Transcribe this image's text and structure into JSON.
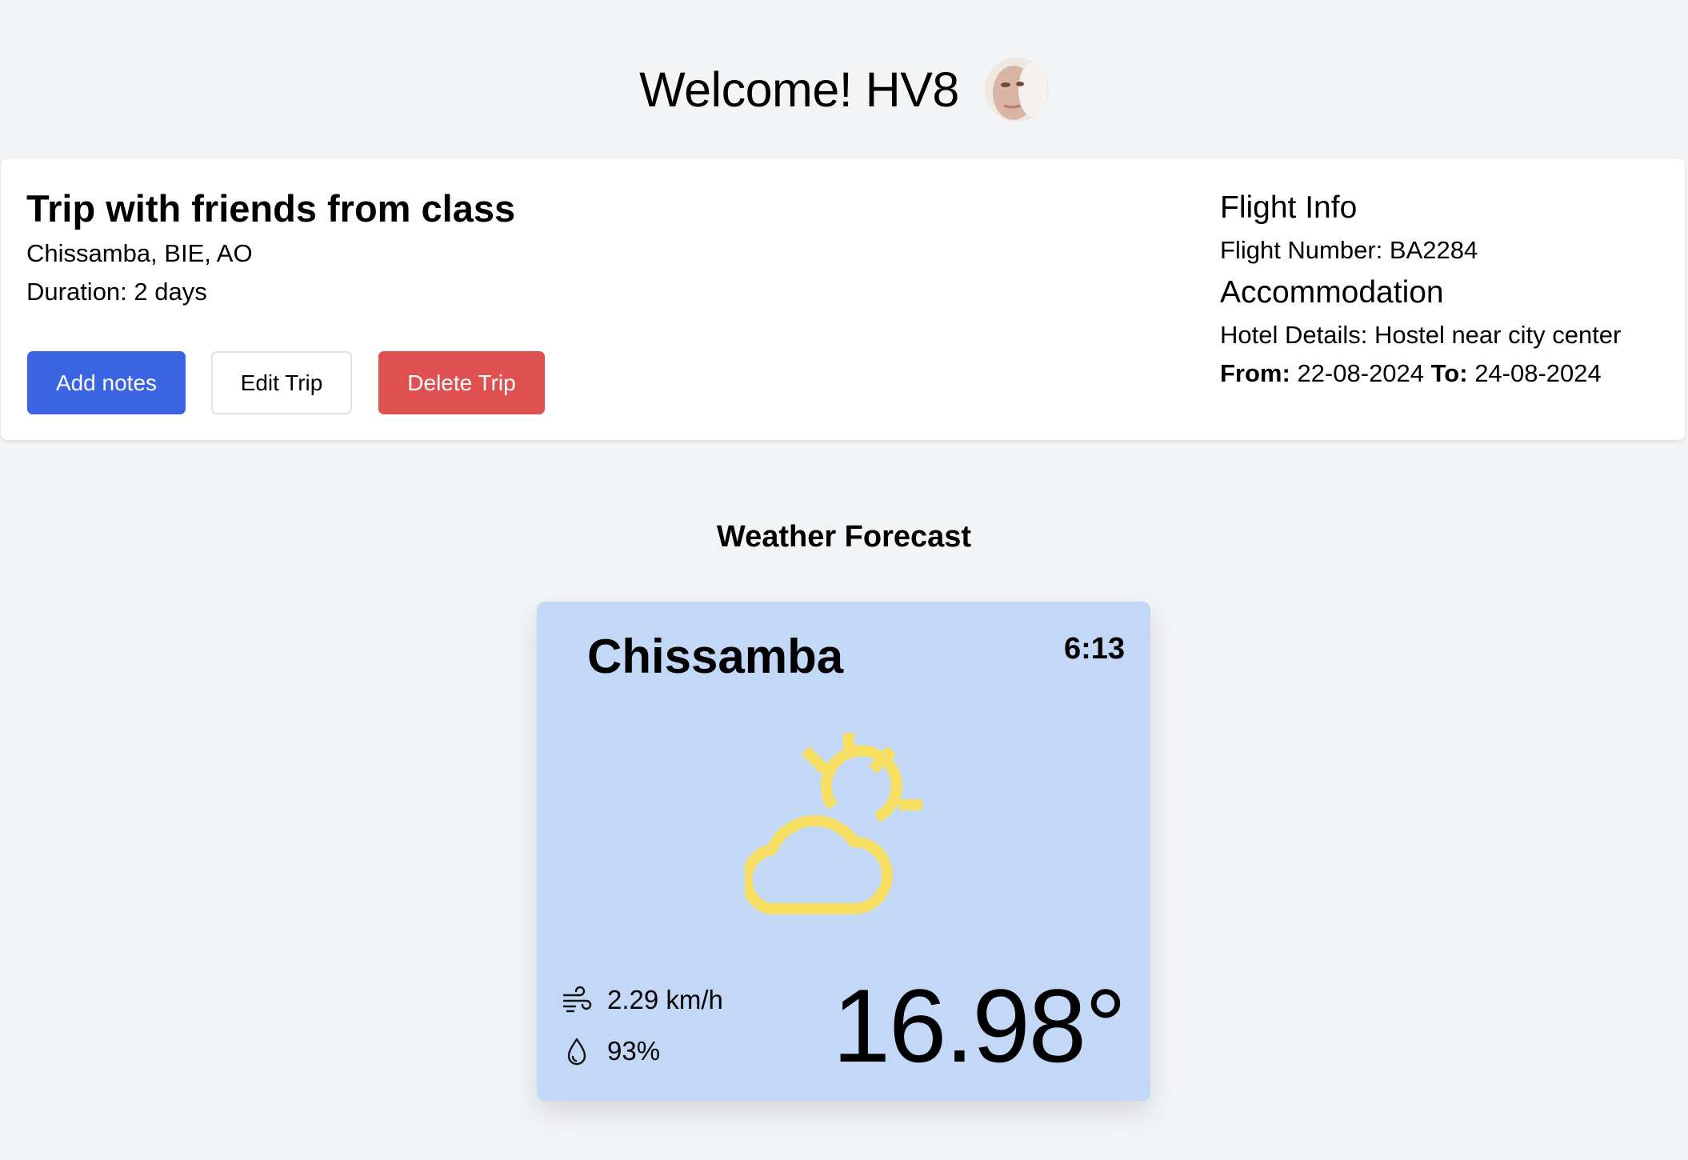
{
  "header": {
    "welcome": "Welcome! HV8"
  },
  "trip": {
    "title": "Trip with friends from class",
    "location": "Chissamba, BIE, AO",
    "duration": "Duration: 2 days",
    "buttons": {
      "add_notes": "Add notes",
      "edit": "Edit Trip",
      "delete": "Delete Trip"
    },
    "flight": {
      "heading": "Flight Info",
      "number": "Flight Number: BA2284"
    },
    "accommodation": {
      "heading": "Accommodation",
      "hotel": "Hotel Details: Hostel near city center",
      "from_label": "From:",
      "from_date": "22-08-2024",
      "to_label": "To:",
      "to_date": "24-08-2024"
    }
  },
  "weather": {
    "heading": "Weather Forecast",
    "city": "Chissamba",
    "time": "6:13",
    "icon": "partly-cloudy-icon",
    "wind": "2.29 km/h",
    "humidity": "93%",
    "temperature": "16.98°"
  },
  "colors": {
    "background": "#f3f4f6",
    "primary_button": "#3b64e3",
    "danger_button": "#df5050",
    "weather_card": "#c3d8f7",
    "weather_icon": "#f6df62"
  }
}
